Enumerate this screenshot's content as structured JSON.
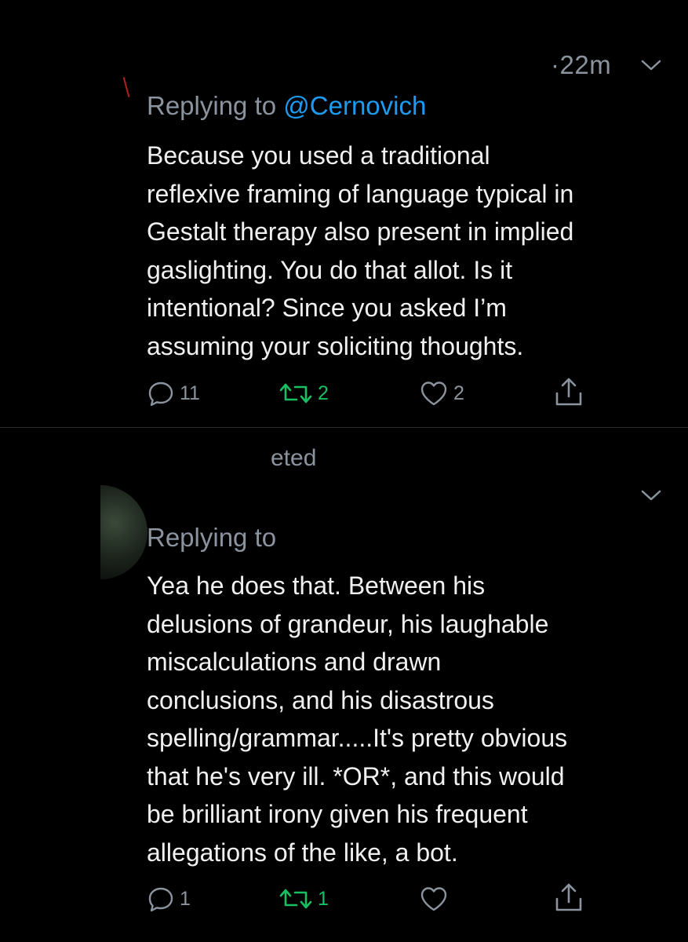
{
  "theme": {
    "background": "#000000",
    "text": "#f0f0f0",
    "muted": "#8b949e",
    "link": "#1d9bf0",
    "retweet": "#17bf63",
    "divider": "#2a2d31"
  },
  "tweets": [
    {
      "timestamp": "·22m",
      "reply_prefix": "Replying to",
      "reply_handle": "@Cernovich",
      "text": "Because you used a traditional\nreflexive framing of language typical in\nGestalt therapy also present in implied\ngaslighting. You do that allot. Is it\nintentional? Since you asked I’m\nassuming your soliciting thoughts.",
      "actions": {
        "reply_count": "11",
        "retweet_count": "2",
        "like_count": "2",
        "reply_icon": "reply-icon",
        "retweet_icon": "retweet-icon",
        "like_icon": "heart-icon",
        "share_icon": "share-icon"
      }
    },
    {
      "retweeted_label": "eted",
      "reply_prefix": "Replying to",
      "reply_handle": "",
      "text": "Yea he does that.  Between his\ndelusions of grandeur, his laughable\nmiscalculations and drawn\nconclusions, and his disastrous\nspelling/grammar.....It's pretty obvious\nthat he's very ill.  *OR*, and this would\nbe brilliant irony given his frequent\nallegations of the like, a bot.",
      "actions": {
        "reply_count": "1",
        "retweet_count": "1",
        "like_count": "",
        "reply_icon": "reply-icon",
        "retweet_icon": "retweet-icon",
        "like_icon": "heart-icon",
        "share_icon": "share-icon"
      }
    }
  ]
}
